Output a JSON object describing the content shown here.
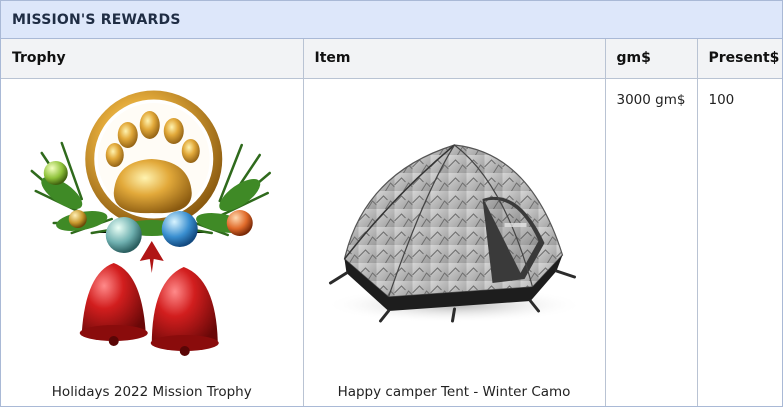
{
  "panel": {
    "title": "MISSION'S REWARDS"
  },
  "table": {
    "headers": {
      "trophy": "Trophy",
      "item": "Item",
      "gm": "gm$",
      "present": "Present$"
    },
    "row": {
      "trophy_caption": "Holidays 2022 Mission Trophy",
      "item_caption": "Happy camper Tent - Winter Camo",
      "gm_value": "3000 gm$",
      "present_value": "100"
    }
  }
}
